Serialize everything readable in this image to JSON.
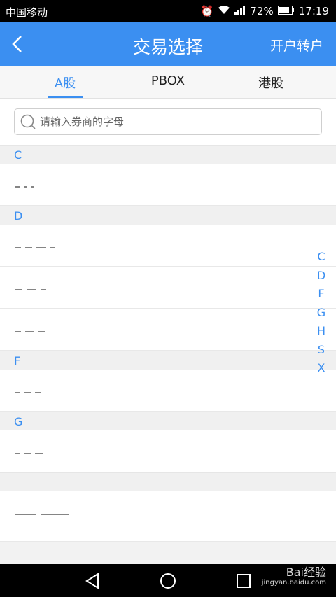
{
  "status_bar": {
    "carrier": "中国移动",
    "battery": "72%",
    "time": "17:19"
  },
  "header": {
    "title": "交易选择",
    "action": "开户转户"
  },
  "tabs": [
    {
      "label": "A股",
      "active": true
    },
    {
      "label": "PBOX",
      "active": false
    },
    {
      "label": "港股",
      "active": false
    }
  ],
  "search": {
    "placeholder": "请输入券商的字母",
    "value": ""
  },
  "sections": [
    {
      "letter": "C",
      "items": 1
    },
    {
      "letter": "D",
      "items": 3
    },
    {
      "letter": "F",
      "items": 1
    },
    {
      "letter": "G",
      "items": 1
    }
  ],
  "index_letters": [
    "C",
    "D",
    "F",
    "G",
    "H",
    "S",
    "X"
  ],
  "watermark": {
    "brand": "Bai经验",
    "url": "jingyan.baidu.com"
  },
  "colors": {
    "accent": "#3b8ff1",
    "status_bar": "#000000",
    "list_bg": "#ffffff"
  }
}
